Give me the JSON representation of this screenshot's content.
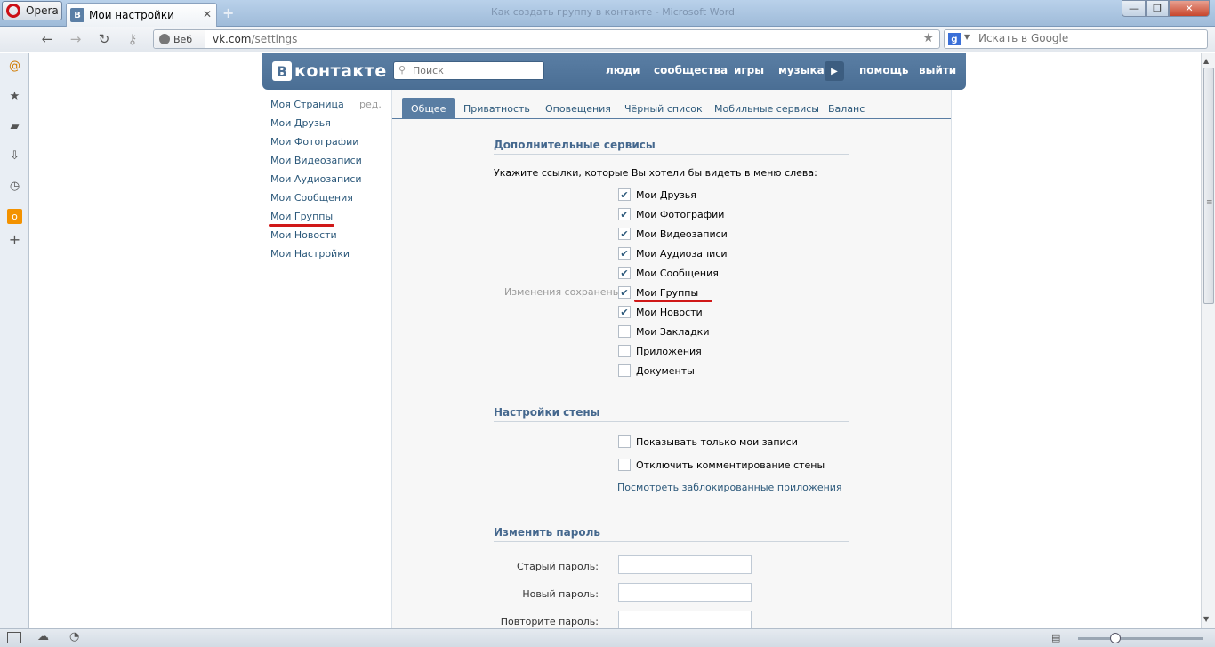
{
  "browser": {
    "menu_button": "Opera",
    "tab_title": "Мои настройки",
    "tab_favicon": "В",
    "window_title": "Как создать группу в контакте - Microsoft Word",
    "address_badge": "Веб",
    "url_domain": "vk.com",
    "url_path": "/settings",
    "search_engine_icon": "g",
    "search_placeholder": "Искать в Google"
  },
  "vk": {
    "logo_letter": "В",
    "logo_text": "контакте",
    "search_placeholder": "Поиск",
    "nav": {
      "people": "люди",
      "communities": "сообщества",
      "games": "игры",
      "music": "музыка",
      "help": "помощь",
      "exit": "выйти"
    }
  },
  "left_menu": {
    "edit": "ред.",
    "items": [
      "Моя Страница",
      "Мои Друзья",
      "Мои Фотографии",
      "Мои Видеозаписи",
      "Мои Аудиозаписи",
      "Мои Сообщения",
      "Мои Группы",
      "Мои Новости",
      "Мои Настройки"
    ]
  },
  "tabs": [
    "Общее",
    "Приватность",
    "Оповещения",
    "Чёрный список",
    "Мобильные сервисы",
    "Баланс"
  ],
  "services": {
    "title": "Дополнительные сервисы",
    "intro": "Укажите ссылки, которые Вы хотели бы видеть в меню слева:",
    "saved_note": "Изменения сохранены",
    "items": [
      {
        "label": "Мои Друзья",
        "checked": true
      },
      {
        "label": "Мои Фотографии",
        "checked": true
      },
      {
        "label": "Мои Видеозаписи",
        "checked": true
      },
      {
        "label": "Мои Аудиозаписи",
        "checked": true
      },
      {
        "label": "Мои Сообщения",
        "checked": true
      },
      {
        "label": "Мои Группы",
        "checked": true
      },
      {
        "label": "Мои Новости",
        "checked": true
      },
      {
        "label": "Мои Закладки",
        "checked": false
      },
      {
        "label": "Приложения",
        "checked": false
      },
      {
        "label": "Документы",
        "checked": false
      }
    ]
  },
  "wall": {
    "title": "Настройки стены",
    "only_my_posts": "Показывать только мои записи",
    "disable_comments": "Отключить комментирование стены",
    "blocked_apps_link": "Посмотреть заблокированные приложения"
  },
  "password": {
    "title": "Изменить пароль",
    "old_label": "Старый пароль:",
    "new_label": "Новый пароль:",
    "repeat_label": "Повторите пароль:"
  },
  "zoom_level": 0.3,
  "colors": {
    "vk_header": "#5a7ea4",
    "vk_link": "#2b587a",
    "highlight_underline": "#d01818"
  }
}
